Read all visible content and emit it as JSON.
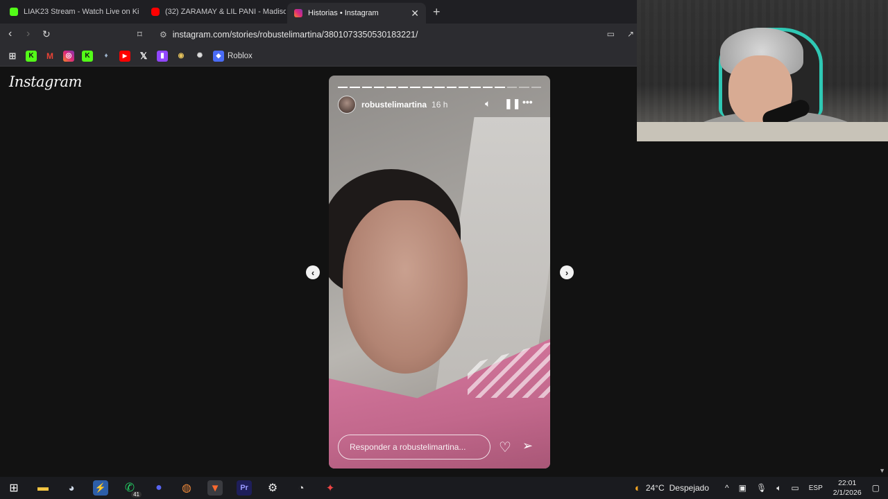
{
  "tabs": [
    {
      "label": "LIAK23 Stream - Watch Live on Ki",
      "favicon": "kick-icon",
      "color": "#53fc18"
    },
    {
      "label": "(32) ZARAMAY & LIL PANI - Madison",
      "favicon": "youtube-icon",
      "color": "#ff0000"
    },
    {
      "label": "Historias • Instagram",
      "favicon": "instagram-icon",
      "color": "#e1306c"
    }
  ],
  "toolbar": {
    "url": "instagram.com/stories/robustelimartina/3801073350530183221/"
  },
  "bookmarks": {
    "roblox_label": "Roblox"
  },
  "page": {
    "logo": "Instagram"
  },
  "story": {
    "username": "robustelimartina",
    "time_ago": "16 h",
    "reply_placeholder": "Responder a robustelimartina...",
    "segments_total": 17,
    "segments_done": 14
  },
  "taskbar": {
    "whatsapp_badge": "41",
    "weather_temp": "24°C",
    "weather_desc": "Despejado",
    "language": "ESP",
    "time": "22:01",
    "date": "2/1/2026"
  },
  "colors": {
    "accent_teal": "#2fc8b4",
    "kick_green": "#53fc18"
  }
}
